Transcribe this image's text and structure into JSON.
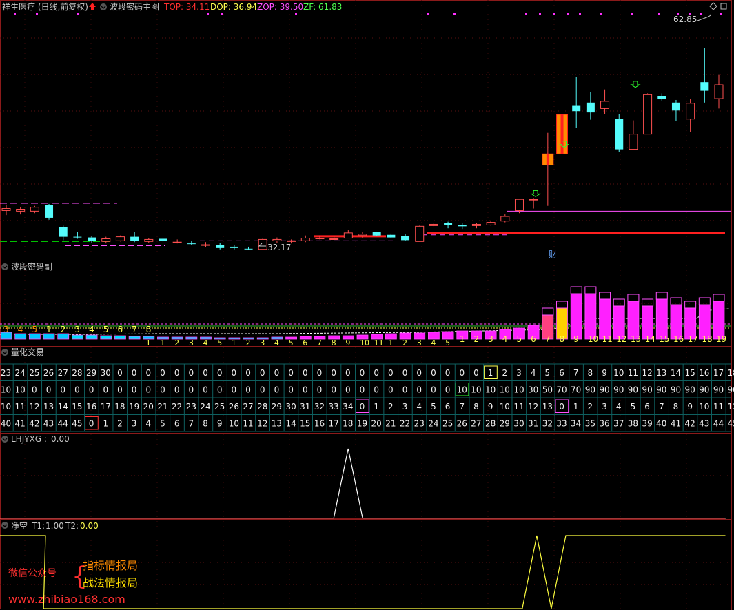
{
  "main_header": {
    "stock": "祥生医疗 (日线,前复权)",
    "indicator": "波段密码主图",
    "top_label": "TOP: 34.11",
    "dop_label": "DOP: 36.94",
    "zop_label": "ZOP: 39.50",
    "zf_label": "ZF: 61.83"
  },
  "price_labels": {
    "high": "62.85",
    "low": "32.17",
    "cai": "财"
  },
  "sub_header": {
    "title": "波段密码副"
  },
  "quant_header": {
    "title": "量化交易"
  },
  "lhjyxg_header": {
    "label": "LHJYXG :",
    "value": "0.00"
  },
  "jk_header": {
    "title": "净空",
    "t1_label": "T1:",
    "t1_value": "1.00",
    "t2_label": "T2:",
    "t2_value": "0.00"
  },
  "watermark": {
    "wechat": "微信公众号",
    "line1": "指标情报局",
    "line2": "战法情报局",
    "url": "www.zhibiao168.com"
  },
  "colors": {
    "up": "#ff5050",
    "down": "#54fcfc",
    "top": "#ff3030",
    "dop": "#ffff50",
    "zop": "#ff50ff",
    "zf": "#50ff50"
  },
  "chart_data": [
    {
      "type": "candlestick",
      "title": "波段密码主图",
      "candles": [
        {
          "o": 38.2,
          "h": 39.1,
          "l": 37.5,
          "c": 38.5
        },
        {
          "o": 38.1,
          "h": 38.7,
          "l": 37.6,
          "c": 38.4
        },
        {
          "o": 38.1,
          "h": 38.9,
          "l": 37.8,
          "c": 38.7
        },
        {
          "o": 39.0,
          "h": 39.2,
          "l": 36.8,
          "c": 37.1
        },
        {
          "o": 35.7,
          "h": 35.9,
          "l": 33.7,
          "c": 34.2
        },
        {
          "o": 34.2,
          "h": 34.9,
          "l": 33.9,
          "c": 34.1
        },
        {
          "o": 34.1,
          "h": 34.3,
          "l": 33.3,
          "c": 33.6
        },
        {
          "o": 33.5,
          "h": 34.2,
          "l": 33.2,
          "c": 33.9
        },
        {
          "o": 33.6,
          "h": 34.4,
          "l": 33.5,
          "c": 34.2
        },
        {
          "o": 34.2,
          "h": 34.9,
          "l": 33.4,
          "c": 33.6
        },
        {
          "o": 33.5,
          "h": 34.0,
          "l": 33.3,
          "c": 33.8
        },
        {
          "o": 33.9,
          "h": 34.1,
          "l": 33.4,
          "c": 33.6
        },
        {
          "o": 33.4,
          "h": 33.8,
          "l": 33.2,
          "c": 33.4
        },
        {
          "o": 33.2,
          "h": 33.6,
          "l": 33.0,
          "c": 33.1
        },
        {
          "o": 33.0,
          "h": 33.4,
          "l": 32.6,
          "c": 33.0
        },
        {
          "o": 33.0,
          "h": 33.3,
          "l": 32.3,
          "c": 32.5
        },
        {
          "o": 32.7,
          "h": 32.9,
          "l": 32.3,
          "c": 32.5
        },
        {
          "o": 32.4,
          "h": 32.7,
          "l": 32.2,
          "c": 32.3
        },
        {
          "o": 32.3,
          "h": 34.0,
          "l": 32.17,
          "c": 33.8
        },
        {
          "o": 33.6,
          "h": 34.1,
          "l": 33.3,
          "c": 33.8
        },
        {
          "o": 33.6,
          "h": 33.8,
          "l": 33.2,
          "c": 33.6
        },
        {
          "o": 33.6,
          "h": 34.4,
          "l": 33.4,
          "c": 34.0
        },
        {
          "o": 34.0,
          "h": 34.4,
          "l": 33.8,
          "c": 34.0
        },
        {
          "o": 33.9,
          "h": 34.3,
          "l": 33.9,
          "c": 33.9
        },
        {
          "o": 34.0,
          "h": 35.2,
          "l": 34.0,
          "c": 34.8
        },
        {
          "o": 34.4,
          "h": 35.0,
          "l": 34.0,
          "c": 34.6
        },
        {
          "o": 34.9,
          "h": 35.0,
          "l": 34.3,
          "c": 34.4
        },
        {
          "o": 34.5,
          "h": 34.7,
          "l": 34.0,
          "c": 34.1
        },
        {
          "o": 34.3,
          "h": 34.6,
          "l": 33.6,
          "c": 33.7
        },
        {
          "o": 33.5,
          "h": 35.9,
          "l": 33.6,
          "c": 35.8
        },
        {
          "o": 35.9,
          "h": 36.3,
          "l": 35.8,
          "c": 36.1
        },
        {
          "o": 36.3,
          "h": 36.5,
          "l": 35.5,
          "c": 36.0
        },
        {
          "o": 36.0,
          "h": 36.3,
          "l": 35.4,
          "c": 35.8
        },
        {
          "o": 35.9,
          "h": 36.3,
          "l": 35.5,
          "c": 36.1
        },
        {
          "o": 36.0,
          "h": 36.7,
          "l": 35.9,
          "c": 36.4
        },
        {
          "o": 36.6,
          "h": 37.6,
          "l": 36.4,
          "c": 37.3
        },
        {
          "o": 38.2,
          "h": 40.0,
          "l": 37.8,
          "c": 39.9
        },
        {
          "o": 39.9,
          "h": 40.1,
          "l": 38.5,
          "c": 39.9
        },
        {
          "o": 45.1,
          "h": 50.0,
          "l": 38.9,
          "c": 46.8
        },
        {
          "o": 46.8,
          "h": 52.9,
          "l": 46.8,
          "c": 52.8
        },
        {
          "o": 54.1,
          "h": 58.5,
          "l": 50.8,
          "c": 53.3
        },
        {
          "o": 54.6,
          "h": 56.2,
          "l": 52.0,
          "c": 53.1
        },
        {
          "o": 53.7,
          "h": 56.6,
          "l": 52.8,
          "c": 54.8
        },
        {
          "o": 52.1,
          "h": 52.8,
          "l": 47.1,
          "c": 47.5
        },
        {
          "o": 47.5,
          "h": 51.9,
          "l": 47.5,
          "c": 49.8
        },
        {
          "o": 49.8,
          "h": 56.0,
          "l": 49.8,
          "c": 55.8
        },
        {
          "o": 55.6,
          "h": 56.0,
          "l": 54.9,
          "c": 55.1
        },
        {
          "o": 54.6,
          "h": 55.0,
          "l": 51.8,
          "c": 53.4
        },
        {
          "o": 52.1,
          "h": 55.2,
          "l": 50.1,
          "c": 54.5
        },
        {
          "o": 57.7,
          "h": 62.85,
          "l": 54.6,
          "c": 56.4
        },
        {
          "o": 55.2,
          "h": 58.8,
          "l": 53.7,
          "c": 57.3
        }
      ],
      "low_label": "32.17",
      "high_label": "62.85"
    },
    {
      "type": "table",
      "title": "量化交易",
      "rows": [
        [
          23,
          24,
          25,
          26,
          27,
          28,
          29,
          30,
          0,
          0,
          0,
          0,
          0,
          0,
          0,
          0,
          0,
          0,
          0,
          0,
          0,
          0,
          0,
          0,
          0,
          0,
          0,
          0,
          0,
          0,
          0,
          0,
          0,
          0,
          1,
          2,
          3,
          4,
          5,
          6,
          7,
          8,
          9,
          10,
          11,
          12,
          13,
          14,
          15,
          16,
          17,
          18
        ],
        [
          10,
          10,
          0,
          0,
          0,
          0,
          0,
          0,
          0,
          0,
          0,
          0,
          0,
          0,
          0,
          0,
          0,
          0,
          0,
          0,
          0,
          0,
          0,
          0,
          0,
          0,
          0,
          0,
          0,
          0,
          0,
          0,
          10,
          10,
          10,
          10,
          10,
          30,
          50,
          70,
          70,
          90,
          90,
          90,
          90,
          90,
          90,
          90,
          90,
          90,
          90,
          90
        ],
        [
          10,
          11,
          12,
          13,
          14,
          15,
          16,
          17,
          18,
          19,
          20,
          21,
          22,
          23,
          24,
          25,
          26,
          27,
          28,
          29,
          30,
          31,
          32,
          33,
          34,
          0,
          1,
          2,
          3,
          4,
          5,
          6,
          7,
          8,
          9,
          10,
          11,
          12,
          13,
          0,
          1,
          2,
          3,
          4,
          5,
          6,
          7,
          8,
          9,
          10,
          11,
          12
        ],
        [
          40,
          41,
          42,
          43,
          44,
          45,
          0,
          1,
          2,
          3,
          4,
          5,
          6,
          7,
          8,
          9,
          10,
          11,
          12,
          13,
          14,
          15,
          16,
          17,
          18,
          19,
          20,
          21,
          22,
          23,
          24,
          25,
          26,
          27,
          28,
          29,
          30,
          31,
          32,
          33,
          34,
          35,
          36,
          37,
          38,
          39,
          40,
          41,
          42,
          43,
          44,
          45
        ]
      ]
    },
    {
      "type": "line",
      "title": "LHJYXG",
      "values": [
        0,
        0,
        0,
        0,
        0,
        0,
        0,
        0,
        0,
        0,
        0,
        0,
        0,
        0,
        0,
        0,
        0,
        0,
        0,
        0,
        0,
        0,
        0,
        0,
        1,
        0,
        0,
        0,
        0,
        0,
        0,
        0,
        0,
        0,
        0,
        0,
        0,
        0,
        0,
        0,
        0,
        0,
        0,
        0,
        0,
        0,
        0,
        0,
        0,
        0,
        0
      ]
    },
    {
      "type": "line",
      "title": "净空",
      "values": [
        1,
        1,
        1,
        0,
        0,
        0,
        0,
        0,
        0,
        0,
        0,
        0,
        0,
        0,
        0,
        0,
        0,
        0,
        0,
        0,
        0,
        0,
        0,
        0,
        0,
        0,
        0,
        0,
        0,
        0,
        0,
        0,
        0,
        0,
        0,
        0,
        0,
        1,
        0,
        1,
        1,
        1,
        1,
        1,
        1,
        1,
        1,
        1,
        1,
        1,
        1
      ]
    }
  ]
}
